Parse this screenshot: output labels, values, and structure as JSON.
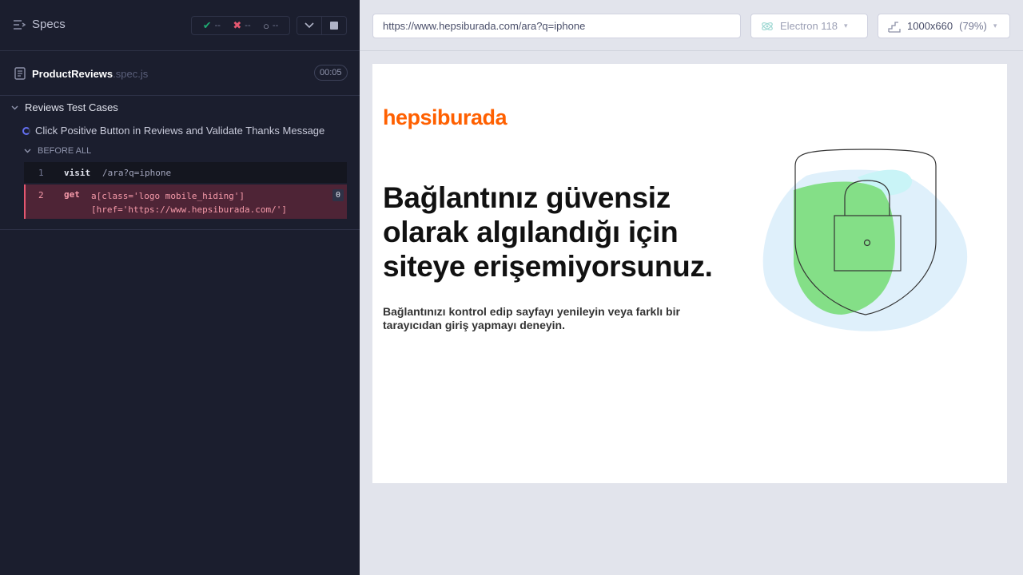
{
  "runner": {
    "specs_label": "Specs",
    "stats": {
      "passed": "--",
      "failed": "--",
      "pending": "--"
    },
    "spec_file": {
      "name": "ProductReviews",
      "ext": ".spec.js",
      "duration": "00:05"
    },
    "suite_title": "Reviews Test Cases",
    "test_title": "Click Positive Button in Reviews and Validate Thanks Message",
    "hook_title": "BEFORE ALL",
    "commands": [
      {
        "number": "1",
        "name": "visit",
        "message": "/ara?q=iphone"
      },
      {
        "number": "2",
        "name": "get",
        "message": "a[class='logo mobile_hiding'] [href='https://www.hepsiburada.com/']",
        "count": "0"
      }
    ]
  },
  "browser": {
    "url": "https://www.hepsiburada.com/ara?q=iphone",
    "browser_name": "Electron 118",
    "viewport": "1000x660",
    "zoom": "(79%)"
  },
  "page": {
    "logo": "hepsiburada",
    "headline": "Bağlantınız güvensiz olarak algılandığı için siteye erişemiyorsunuz.",
    "subtext": "Bağlantınızı kontrol edip sayfayı yenileyin veya farklı bir tarayıcıdan giriş yapmayı deneyin."
  },
  "colors": {
    "brand": "#ff6000",
    "passed": "#1fa971",
    "failed": "#e45770",
    "runner_bg": "#1b1e2e"
  },
  "icons": [
    "specs-list-icon",
    "check-icon",
    "x-icon",
    "pending-circle-icon",
    "chevron-down-icon",
    "stop-icon",
    "document-icon",
    "electron-icon",
    "viewport-icon",
    "shield-lock-illustration"
  ]
}
